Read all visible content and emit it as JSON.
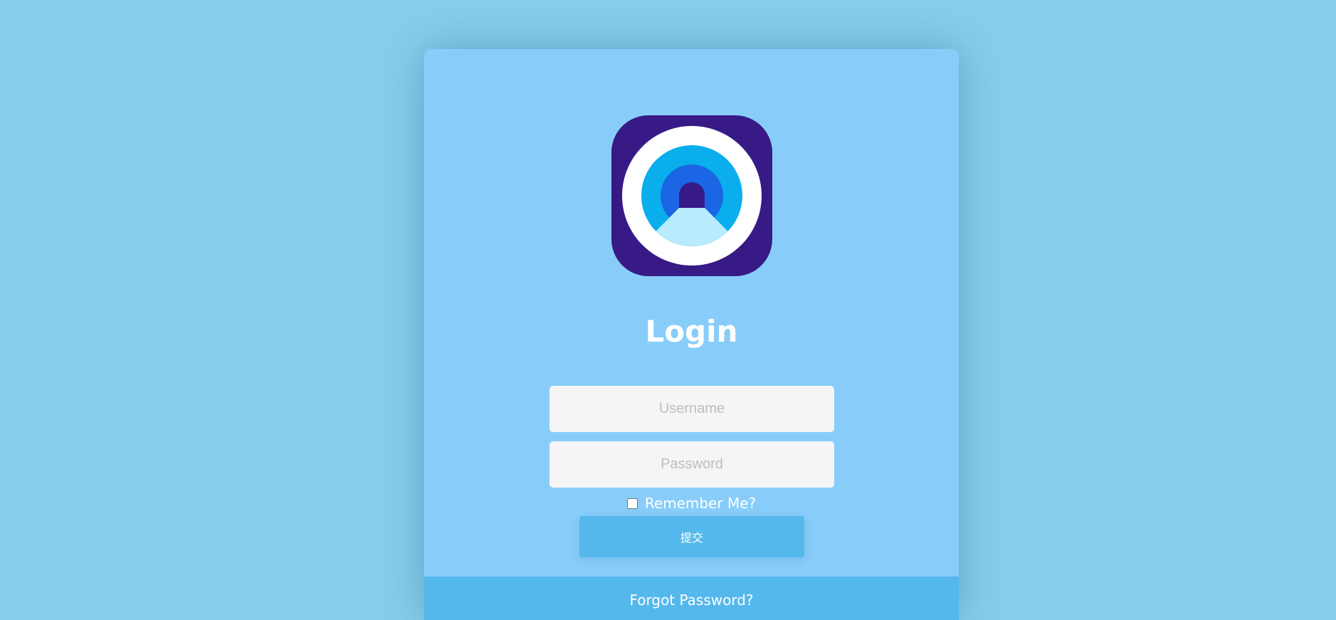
{
  "login": {
    "title": "Login",
    "username_placeholder": "Username",
    "password_placeholder": "Password",
    "remember_label": "Remember Me?",
    "submit_label": "提交",
    "forgot_label": "Forgot Password?"
  },
  "logo": {
    "icon": "tunnel-logo-icon",
    "colors": {
      "background": "#371a86",
      "ring": "#ffffff",
      "outer": "#0aaeed",
      "inner": "#1a66e4",
      "road": "#b8ebfd"
    }
  },
  "colors": {
    "page_background": "#87ceeb",
    "card_background": "#88cdfa",
    "accent": "#55b8ec",
    "input_background": "#f5f5f5"
  }
}
